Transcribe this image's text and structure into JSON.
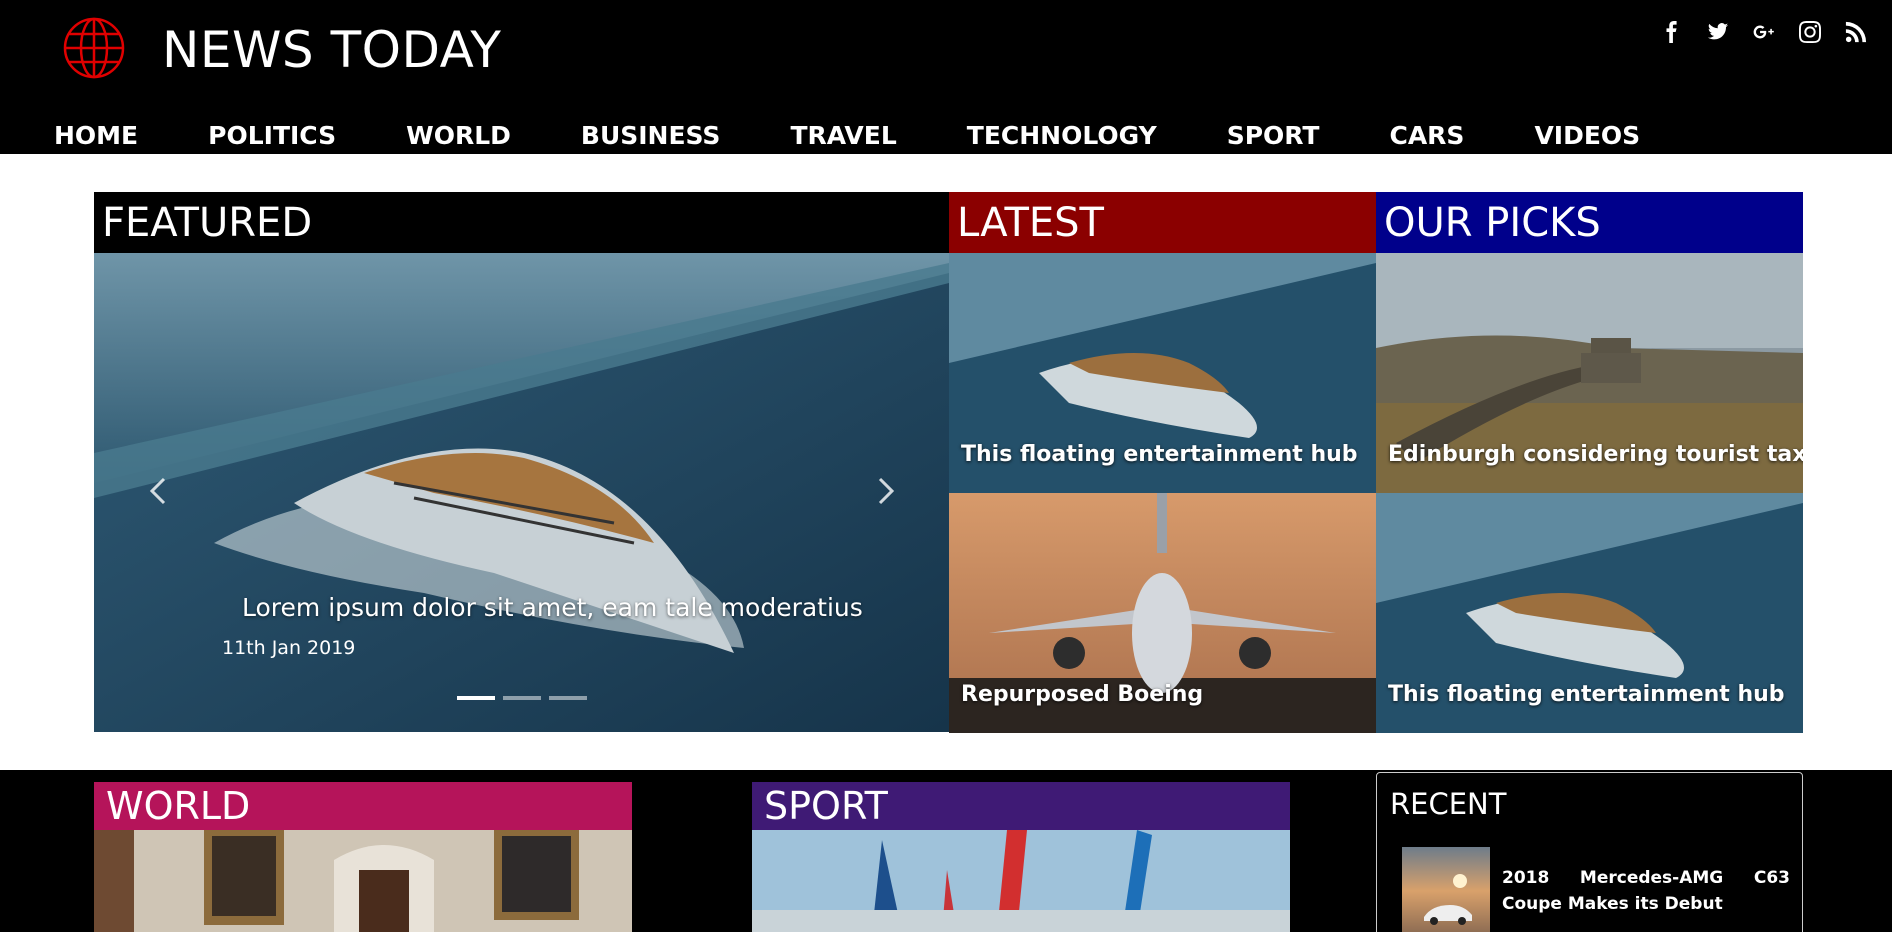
{
  "header": {
    "site_title": "NEWS TODAY",
    "logo_icon": "globe-icon",
    "logo_color": "#e00000",
    "social": [
      {
        "name": "facebook-icon",
        "glyph": "f"
      },
      {
        "name": "twitter-icon",
        "glyph": ""
      },
      {
        "name": "google-plus-icon",
        "glyph": "G+"
      },
      {
        "name": "instagram-icon",
        "glyph": ""
      },
      {
        "name": "rss-icon",
        "glyph": ""
      }
    ]
  },
  "nav": {
    "items": [
      "HOME",
      "POLITICS",
      "WORLD",
      "BUSINESS",
      "TRAVEL",
      "TECHNOLOGY",
      "SPORT",
      "CARS",
      "VIDEOS"
    ]
  },
  "sections": {
    "featured": "FEATURED",
    "latest": "LATEST",
    "our_picks": "OUR PICKS",
    "world": "WORLD",
    "sport": "SPORT",
    "recent": "RECENT"
  },
  "colors": {
    "featured": "#000000",
    "latest": "#8b0000",
    "our_picks": "#00008b",
    "world": "#b5145a",
    "sport": "#3f1a75"
  },
  "carousel": {
    "title": "Lorem ipsum dolor sit amet, eam tale moderatius",
    "date": "11th Jan 2019",
    "active_index": 0,
    "slide_count": 3
  },
  "latest": [
    {
      "caption": "This floating entertainment hub"
    },
    {
      "caption": "Repurposed Boeing"
    }
  ],
  "picks": [
    {
      "caption": "Edinburgh considering tourist tax"
    },
    {
      "caption": "This floating entertainment hub"
    }
  ],
  "recent": [
    {
      "text": "2018 Mercedes-AMG C63 Coupe Makes its Debut"
    }
  ]
}
